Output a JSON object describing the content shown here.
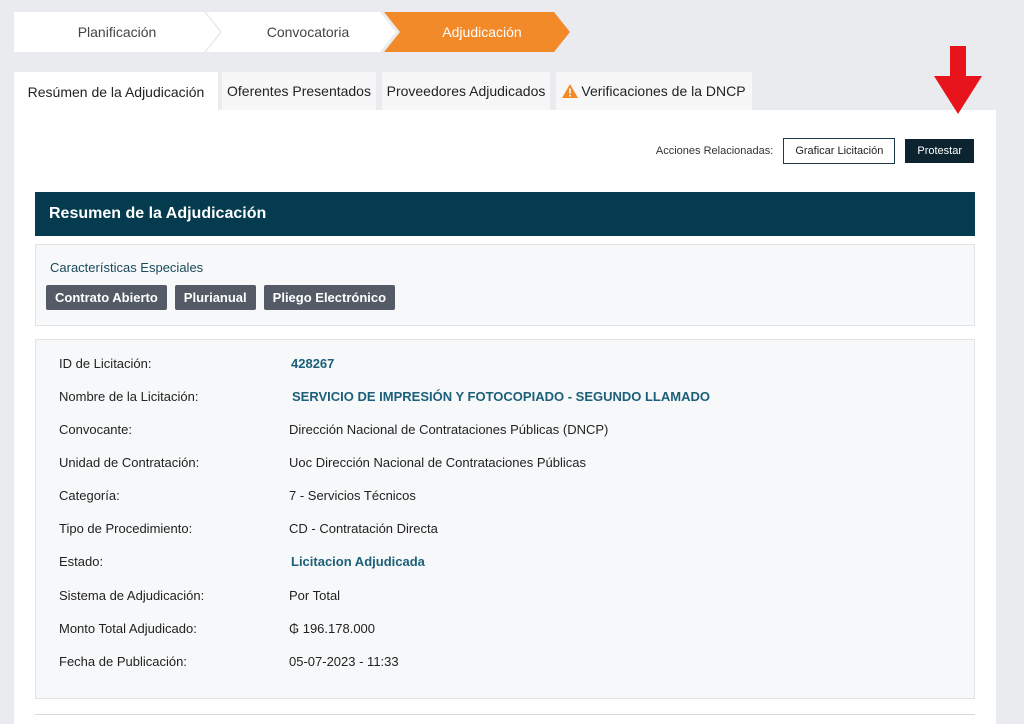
{
  "stepper": {
    "steps": [
      {
        "label": "Planificación"
      },
      {
        "label": "Convocatoria"
      },
      {
        "label": "Adjudicación"
      }
    ],
    "active_color": "#f28a2a"
  },
  "tabs": [
    {
      "label": "Resúmen de la Adjudicación"
    },
    {
      "label": "Oferentes Presentados"
    },
    {
      "label": "Proveedores Adjudicados"
    },
    {
      "label": "Verificaciones de la DNCP",
      "icon": "warning-icon"
    }
  ],
  "actions": {
    "label": "Acciones Relacionadas:",
    "graficar_label": "Graficar Licitación",
    "protestar_label": "Protestar"
  },
  "summary": {
    "header": "Resumen de la Adjudicación",
    "header_color": "#053b4e",
    "features_title": "Características Especiales",
    "badges": [
      "Contrato Abierto",
      "Plurianual",
      "Pliego Electrónico"
    ]
  },
  "details": [
    {
      "label": "ID de Licitación:",
      "value": "428267"
    },
    {
      "label": "Nombre de la Licitación:",
      "value": "SERVICIO DE IMPRESIÓN Y FOTOCOPIADO - SEGUNDO LLAMADO"
    },
    {
      "label": "Convocante:",
      "value": "Dirección Nacional de Contrataciones Públicas (DNCP)"
    },
    {
      "label": "Unidad de Contratación:",
      "value": "Uoc Dirección Nacional de Contrataciones Públicas"
    },
    {
      "label": "Categoría:",
      "value": "7 - Servicios Técnicos"
    },
    {
      "label": "Tipo de Procedimiento:",
      "value": "CD - Contratación Directa"
    },
    {
      "label": "Estado:",
      "value": "Licitacion Adjudicada"
    },
    {
      "label": "Sistema de Adjudicación:",
      "value": "Por Total"
    },
    {
      "label": "Monto Total Adjudicado:",
      "value": "₲ 196.178.000"
    },
    {
      "label": "Fecha de Publicación:",
      "value": "05-07-2023 - 11:33"
    }
  ],
  "annotation": {
    "icon": "red-arrow-down-icon",
    "color": "#e8141b"
  }
}
